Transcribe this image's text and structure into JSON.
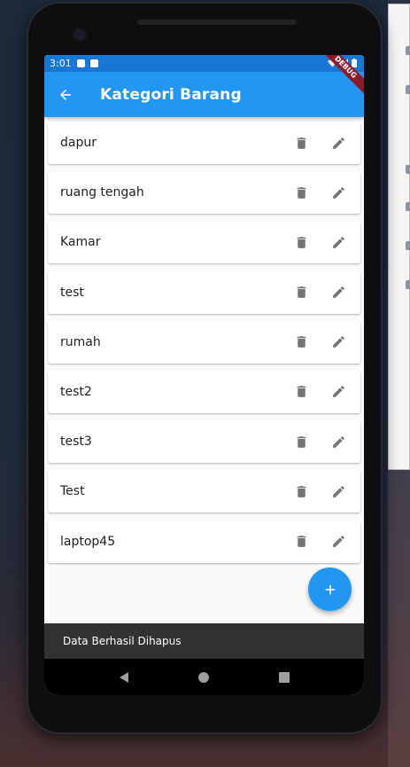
{
  "status_bar": {
    "time": "3:01"
  },
  "debug_banner": "DEBUG",
  "app_bar": {
    "title": "Kategori Barang"
  },
  "categories": [
    {
      "name": "dapur"
    },
    {
      "name": "ruang tengah"
    },
    {
      "name": "Kamar"
    },
    {
      "name": "test"
    },
    {
      "name": "rumah"
    },
    {
      "name": "test2"
    },
    {
      "name": "test3"
    },
    {
      "name": "Test"
    },
    {
      "name": "laptop45"
    }
  ],
  "snackbar": {
    "message": "Data Berhasil Dihapus"
  },
  "colors": {
    "primary": "#2196f3",
    "status_bar": "#1976d2",
    "icon_grey": "#757575",
    "snackbar_bg": "#323232"
  },
  "icons": {
    "back": "arrow-back-icon",
    "delete": "delete-icon",
    "edit": "edit-icon",
    "add": "add-icon",
    "nav_back": "nav-back-icon",
    "nav_home": "nav-home-icon",
    "nav_recents": "nav-recents-icon"
  }
}
